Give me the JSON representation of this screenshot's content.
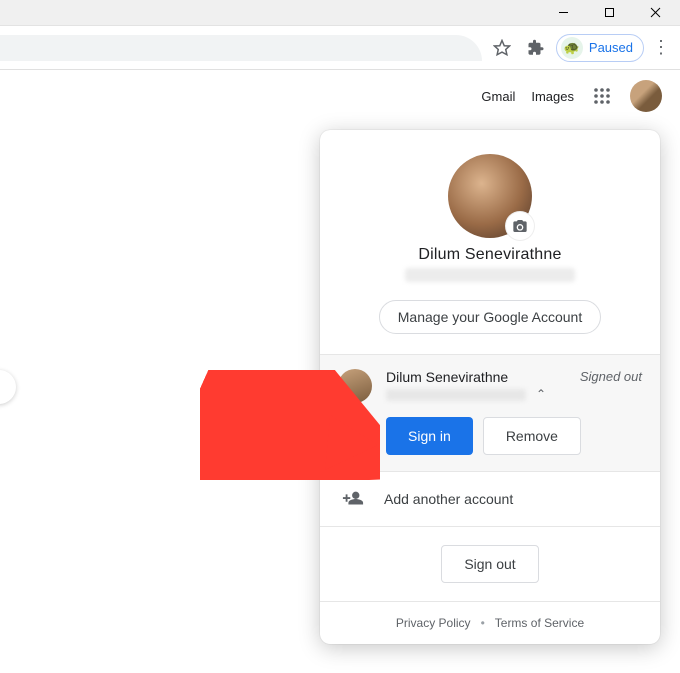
{
  "window_controls": {
    "minimize": "—",
    "maximize": "❐",
    "close": "✕"
  },
  "toolbar": {
    "paused_label": "Paused"
  },
  "ntp": {
    "links": {
      "gmail": "Gmail",
      "images": "Images"
    }
  },
  "account_popup": {
    "primary": {
      "name": "Dilum Senevirathne"
    },
    "manage_label": "Manage your Google Account",
    "other": {
      "name": "Dilum Senevirathne",
      "status": "Signed out",
      "signin_label": "Sign in",
      "remove_label": "Remove"
    },
    "add_label": "Add another account",
    "signout_label": "Sign out",
    "footer": {
      "privacy": "Privacy Policy",
      "terms": "Terms of Service"
    }
  }
}
